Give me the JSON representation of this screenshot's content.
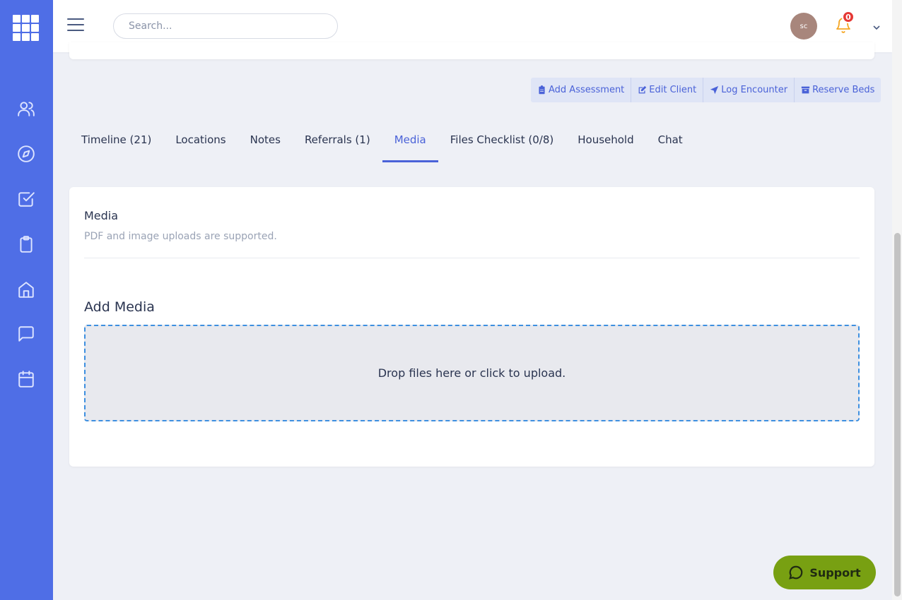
{
  "topbar": {
    "search_placeholder": "Search...",
    "avatar_initials": "sc",
    "notification_count": "0"
  },
  "sidebar": {
    "items": [
      {
        "icon": "users-icon"
      },
      {
        "icon": "compass-icon"
      },
      {
        "icon": "checkbox-icon"
      },
      {
        "icon": "clipboard-icon"
      },
      {
        "icon": "home-icon"
      },
      {
        "icon": "chat-icon"
      },
      {
        "icon": "calendar-icon"
      }
    ]
  },
  "actions": [
    {
      "label": "Add Assessment",
      "icon": "clipboard-icon"
    },
    {
      "label": "Edit Client",
      "icon": "edit-icon"
    },
    {
      "label": "Log Encounter",
      "icon": "location-arrow-icon"
    },
    {
      "label": "Reserve Beds",
      "icon": "archive-icon"
    }
  ],
  "tabs": [
    {
      "label": "Timeline (21)"
    },
    {
      "label": "Locations"
    },
    {
      "label": "Notes"
    },
    {
      "label": "Referrals (1)"
    },
    {
      "label": "Media",
      "active": true
    },
    {
      "label": "Files Checklist (0/8)"
    },
    {
      "label": "Household"
    },
    {
      "label": "Chat"
    }
  ],
  "media": {
    "title": "Media",
    "subtitle": "PDF and image uploads are supported.",
    "add_title": "Add Media",
    "dropzone_text": "Drop files here or click to upload."
  },
  "support": {
    "label": "Support"
  },
  "colors": {
    "sidebar": "#4f6ee6",
    "accent": "#4a62d8",
    "support": "#78a012",
    "badge": "#e53935",
    "bell": "#f5a623"
  }
}
